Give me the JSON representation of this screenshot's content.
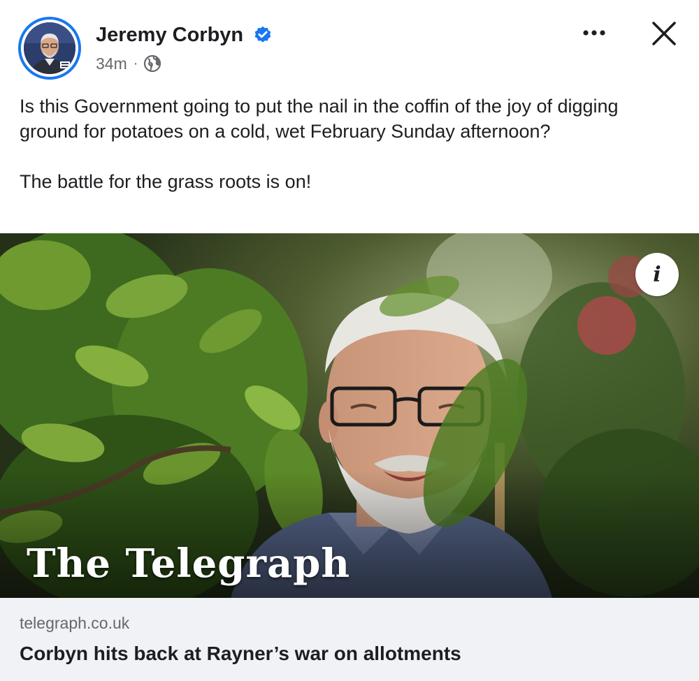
{
  "post": {
    "author": "Jeremy Corbyn",
    "timestamp": "34m",
    "separator": "·",
    "audience_icon": "globe-icon",
    "verified_icon": "verified-badge-icon",
    "text_paragraphs": [
      "Is this Government going to put the nail in the coffin of the joy of digging ground for potatoes on a cold, wet February Sunday afternoon?",
      "The battle for the grass roots is on!"
    ]
  },
  "actions": {
    "more_icon": "more-options-icon",
    "close_icon": "close-icon"
  },
  "link_preview": {
    "publisher_logo": "The Telegraph",
    "info_label": "i",
    "domain": "telegraph.co.uk",
    "title": "Corbyn hits back at Rayner’s war on allotments"
  },
  "colors": {
    "accent": "#1877f2",
    "text_primary": "#1c1e21",
    "text_secondary": "#65676b",
    "footer_bg": "#f0f2f5"
  }
}
